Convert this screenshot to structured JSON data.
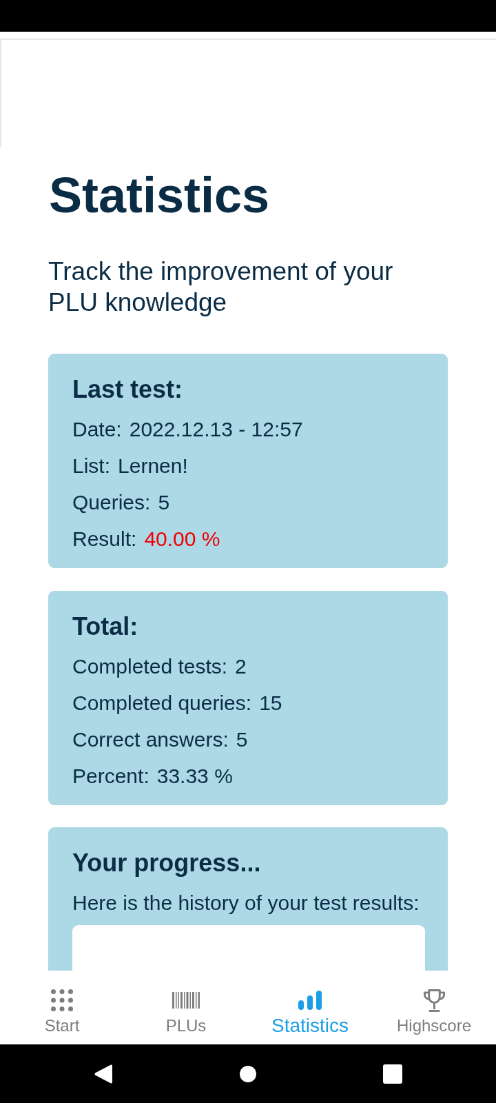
{
  "title": "Statistics",
  "subtitle": "Track the improvement of your PLU knowledge",
  "cards": [
    {
      "heading": "Last test:",
      "rows": [
        {
          "label": "Date:",
          "value": "2022.12.13 - 12:57",
          "alert": false
        },
        {
          "label": "List:",
          "value": "Lernen!",
          "alert": false
        },
        {
          "label": "Queries:",
          "value": "5",
          "alert": false
        },
        {
          "label": "Result:",
          "value": "40.00 %",
          "alert": true
        }
      ]
    },
    {
      "heading": "Total:",
      "rows": [
        {
          "label": "Completed tests:",
          "value": "2",
          "alert": false
        },
        {
          "label": "Completed queries:",
          "value": "15",
          "alert": false
        },
        {
          "label": "Correct answers:",
          "value": "5",
          "alert": false
        },
        {
          "label": "Percent:",
          "value": "33.33 %",
          "alert": false
        }
      ]
    }
  ],
  "progress": {
    "heading": "Your progress...",
    "text": "Here is the history of your test results:"
  },
  "bottom_nav": [
    {
      "label": "Start",
      "selected": false
    },
    {
      "label": "PLUs",
      "selected": false
    },
    {
      "label": "Statistics",
      "selected": true
    },
    {
      "label": "Highscore",
      "selected": false
    }
  ]
}
